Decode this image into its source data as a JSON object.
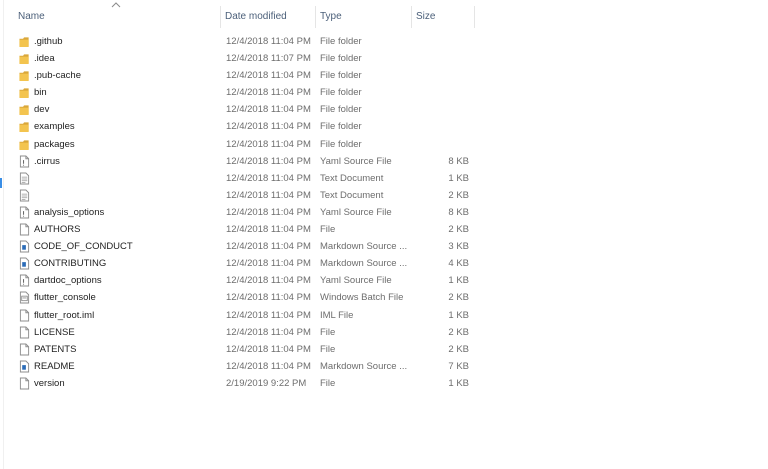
{
  "columns": {
    "name": "Name",
    "date": "Date modified",
    "type": "Type",
    "size": "Size"
  },
  "sort": {
    "column": "name",
    "icon": "sort-up-icon"
  },
  "files": [
    {
      "name": ".github",
      "date": "12/4/2018 11:04 PM",
      "type": "File folder",
      "size": "",
      "icon": "folder-icon"
    },
    {
      "name": ".idea",
      "date": "12/4/2018 11:07 PM",
      "type": "File folder",
      "size": "",
      "icon": "folder-icon"
    },
    {
      "name": ".pub-cache",
      "date": "12/4/2018 11:04 PM",
      "type": "File folder",
      "size": "",
      "icon": "folder-icon"
    },
    {
      "name": "bin",
      "date": "12/4/2018 11:04 PM",
      "type": "File folder",
      "size": "",
      "icon": "folder-icon"
    },
    {
      "name": "dev",
      "date": "12/4/2018 11:04 PM",
      "type": "File folder",
      "size": "",
      "icon": "folder-icon"
    },
    {
      "name": "examples",
      "date": "12/4/2018 11:04 PM",
      "type": "File folder",
      "size": "",
      "icon": "folder-icon"
    },
    {
      "name": "packages",
      "date": "12/4/2018 11:04 PM",
      "type": "File folder",
      "size": "",
      "icon": "folder-icon"
    },
    {
      "name": ".cirrus",
      "date": "12/4/2018 11:04 PM",
      "type": "Yaml Source File",
      "size": "8 KB",
      "icon": "yaml-file-icon"
    },
    {
      "name": "",
      "date": "12/4/2018 11:04 PM",
      "type": "Text Document",
      "size": "1 KB",
      "icon": "text-file-icon"
    },
    {
      "name": "",
      "date": "12/4/2018 11:04 PM",
      "type": "Text Document",
      "size": "2 KB",
      "icon": "text-file-icon"
    },
    {
      "name": "analysis_options",
      "date": "12/4/2018 11:04 PM",
      "type": "Yaml Source File",
      "size": "8 KB",
      "icon": "yaml-file-icon"
    },
    {
      "name": "AUTHORS",
      "date": "12/4/2018 11:04 PM",
      "type": "File",
      "size": "2 KB",
      "icon": "blank-file-icon"
    },
    {
      "name": "CODE_OF_CONDUCT",
      "date": "12/4/2018 11:04 PM",
      "type": "Markdown Source ...",
      "size": "3 KB",
      "icon": "markdown-file-icon"
    },
    {
      "name": "CONTRIBUTING",
      "date": "12/4/2018 11:04 PM",
      "type": "Markdown Source ...",
      "size": "4 KB",
      "icon": "markdown-file-icon"
    },
    {
      "name": "dartdoc_options",
      "date": "12/4/2018 11:04 PM",
      "type": "Yaml Source File",
      "size": "1 KB",
      "icon": "yaml-file-icon"
    },
    {
      "name": "flutter_console",
      "date": "12/4/2018 11:04 PM",
      "type": "Windows Batch File",
      "size": "2 KB",
      "icon": "batch-file-icon"
    },
    {
      "name": "flutter_root.iml",
      "date": "12/4/2018 11:04 PM",
      "type": "IML File",
      "size": "1 KB",
      "icon": "blank-file-icon"
    },
    {
      "name": "LICENSE",
      "date": "12/4/2018 11:04 PM",
      "type": "File",
      "size": "2 KB",
      "icon": "blank-file-icon"
    },
    {
      "name": "PATENTS",
      "date": "12/4/2018 11:04 PM",
      "type": "File",
      "size": "2 KB",
      "icon": "blank-file-icon"
    },
    {
      "name": "README",
      "date": "12/4/2018 11:04 PM",
      "type": "Markdown Source ...",
      "size": "7 KB",
      "icon": "markdown-file-icon"
    },
    {
      "name": "version",
      "date": "2/19/2019 9:22 PM",
      "type": "File",
      "size": "1 KB",
      "icon": "blank-file-icon"
    }
  ],
  "colors": {
    "folder": "#f3c44f",
    "folder_dark": "#d9a73a",
    "header_text": "#4c607a",
    "meta_text": "#6d6d6d",
    "markdown_accent": "#2b6cb8"
  }
}
